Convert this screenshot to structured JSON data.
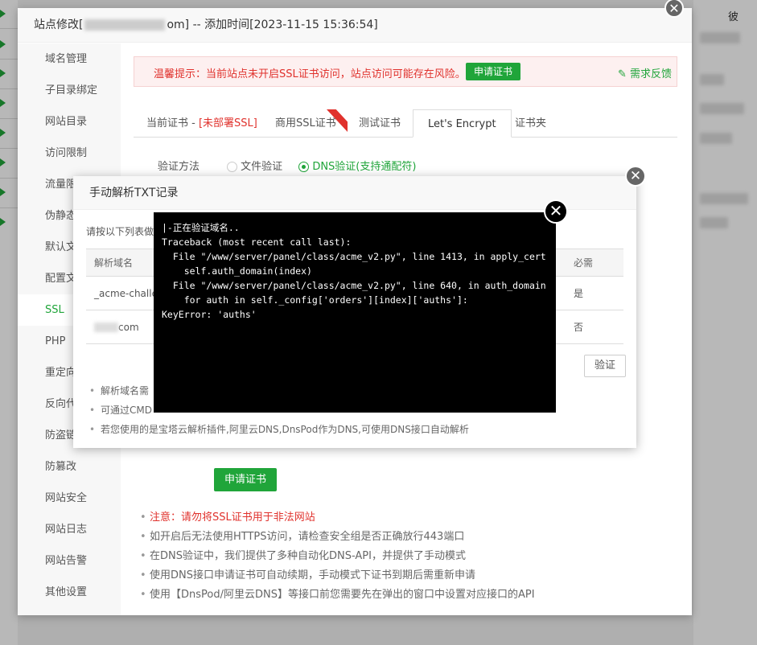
{
  "site_window": {
    "title_prefix": "站点修改[",
    "title_suffix": "om] -- 添加时间[2023-11-15 15:36:54]",
    "close_glyph": "✕"
  },
  "sidebar": {
    "items": [
      {
        "label": "域名管理"
      },
      {
        "label": "子目录绑定"
      },
      {
        "label": "网站目录"
      },
      {
        "label": "访问限制"
      },
      {
        "label": "流量限"
      },
      {
        "label": "伪静态"
      },
      {
        "label": "默认文"
      },
      {
        "label": "配置文"
      },
      {
        "label": "SSL",
        "active": true
      },
      {
        "label": "PHP"
      },
      {
        "label": "重定向"
      },
      {
        "label": "反向代"
      },
      {
        "label": "防盗链"
      },
      {
        "label": "防篡改"
      },
      {
        "label": "网站安全"
      },
      {
        "label": "网站日志"
      },
      {
        "label": "网站告警"
      },
      {
        "label": "其他设置"
      }
    ]
  },
  "warning": {
    "text": "温馨提示：当前站点未开启SSL证书访问，站点访问可能存在风险。",
    "apply_button": "申请证书",
    "feedback": "需求反馈"
  },
  "tabs": [
    {
      "label": "当前证书 - ",
      "extra": "[未部署SSL]"
    },
    {
      "label": "商用SSL证书"
    },
    {
      "label": "测试证书"
    },
    {
      "label": "Let's Encrypt",
      "active": true
    },
    {
      "label": "证书夹"
    }
  ],
  "verify": {
    "label": "验证方法",
    "option_file": "文件验证",
    "option_dns": "DNS验证(支持通配符)"
  },
  "apply_button": "申请证书",
  "notes": [
    {
      "text": "注意：请勿将SSL证书用于非法网站",
      "red": true
    },
    {
      "text": "如开启后无法使用HTTPS访问，请检查安全组是否正确放行443端口"
    },
    {
      "text": "在DNS验证中，我们提供了多种自动化DNS-API，并提供了手动模式"
    },
    {
      "text": "使用DNS接口申请证书可自动续期，手动模式下证书到期后需重新申请"
    },
    {
      "text": "使用【DnsPod/阿里云DNS】等接口前您需要先在弹出的窗口中设置对应接口的API"
    }
  ],
  "txt_dialog": {
    "title": "手动解析TXT记录",
    "hint": "请按以下列表做",
    "columns": {
      "domain": "解析域名",
      "required": "必需"
    },
    "rows": [
      {
        "domain": "_acme-challe",
        "required": "是"
      },
      {
        "domain": "com",
        "required": "否"
      }
    ],
    "verify_button": "验证",
    "notes": [
      {
        "text": "解析域名需"
      },
      {
        "text": "可通过CMD"
      },
      {
        "text": "若您使用的是宝塔云解析插件,阿里云DNS,DnsPod作为DNS,可使用DNS接口自动解析"
      }
    ]
  },
  "log": {
    "lines": [
      "|-正在验证域名..",
      "Traceback (most recent call last):",
      "  File \"/www/server/panel/class/acme_v2.py\", line 1413, in apply_cert",
      "    self.auth_domain(index)",
      "  File \"/www/server/panel/class/acme_v2.py\", line 640, in auth_domain",
      "    for auth in self._config['orders'][index]['auths']:",
      "KeyError: 'auths'"
    ]
  },
  "bg_right_text": "彼"
}
